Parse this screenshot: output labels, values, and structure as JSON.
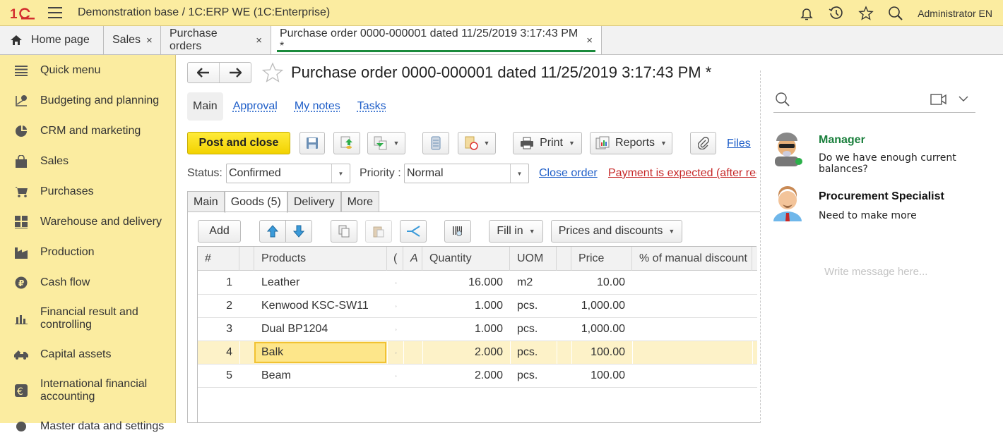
{
  "topbar": {
    "logo": "1C",
    "title": "Demonstration base / 1C:ERP WE  (1C:Enterprise)",
    "icons": [
      "menu-icon",
      "bell-icon",
      "history-icon",
      "star-icon",
      "search-icon"
    ],
    "user": "Administrator EN"
  },
  "tabs": [
    {
      "label": "Home page",
      "icon": "home-icon",
      "closable": false
    },
    {
      "label": "Sales",
      "closable": true
    },
    {
      "label": "Purchase orders",
      "closable": true
    },
    {
      "label": "Purchase order 0000-000001 dated 11/25/2019 3:17:43 PM *",
      "closable": true,
      "active": true
    }
  ],
  "tab_close_glyph": "×",
  "sidebar": {
    "items": [
      {
        "label": "Quick menu",
        "icon": "list-icon"
      },
      {
        "label": "Budgeting and planning",
        "icon": "budget-chart-icon"
      },
      {
        "label": "CRM and marketing",
        "icon": "pie-chart-icon"
      },
      {
        "label": "Sales",
        "icon": "shopping-bag-icon"
      },
      {
        "label": "Purchases",
        "icon": "cart-icon"
      },
      {
        "label": "Warehouse and delivery",
        "icon": "warehouse-icon"
      },
      {
        "label": "Production",
        "icon": "factory-icon"
      },
      {
        "label": "Cash flow",
        "icon": "ruble-coin-icon"
      },
      {
        "label": "Financial result and controlling",
        "icon": "bar-chart-icon"
      },
      {
        "label": "Capital assets",
        "icon": "truck-icon"
      },
      {
        "label": "International financial accounting",
        "icon": "euro-icon"
      },
      {
        "label": "Master data and settings",
        "icon": "gear-icon"
      }
    ]
  },
  "document": {
    "title": "Purchase order 0000-000001 dated 11/25/2019 3:17:43 PM *",
    "form_tabs": [
      {
        "label": "Main",
        "active": true
      },
      {
        "label": "Approval"
      },
      {
        "label": "My notes"
      },
      {
        "label": "Tasks"
      }
    ],
    "toolbar": {
      "post_and_close": "Post and close",
      "print": "Print",
      "reports": "Reports",
      "files": "Files"
    },
    "status_label": "Status:",
    "status_value": "Confirmed",
    "priority_label": "Priority :",
    "priority_value": "Normal",
    "close_order": "Close order",
    "payment_warning": "Payment is expected (after rec",
    "page_tabs": [
      {
        "label": "Main"
      },
      {
        "label": "Goods (5)",
        "active": true
      },
      {
        "label": "Delivery"
      },
      {
        "label": "More"
      }
    ],
    "goods_toolbar": {
      "add": "Add",
      "fill_in": "Fill in",
      "prices_and_discounts": "Prices and discounts"
    },
    "table": {
      "columns": [
        "#",
        "",
        "Products",
        "(",
        "A",
        "Quantity",
        "UOM",
        "",
        "Price",
        "% of manual discount"
      ],
      "rows": [
        {
          "n": "1",
          "product": "Leather",
          "quantity": "16.000",
          "uom": "m2",
          "price": "10.00",
          "discount": ""
        },
        {
          "n": "2",
          "product": "Kenwood KSC-SW11",
          "quantity": "1.000",
          "uom": "pcs.",
          "price": "1,000.00",
          "discount": ""
        },
        {
          "n": "3",
          "product": "Dual BP1204",
          "quantity": "1.000",
          "uom": "pcs.",
          "price": "1,000.00",
          "discount": ""
        },
        {
          "n": "4",
          "product": "Balk",
          "quantity": "2.000",
          "uom": "pcs.",
          "price": "100.00",
          "discount": "",
          "selected": true
        },
        {
          "n": "5",
          "product": "Beam",
          "quantity": "2.000",
          "uom": "pcs.",
          "price": "100.00",
          "discount": ""
        }
      ],
      "char_marker": "◦"
    }
  },
  "chat": {
    "messages": [
      {
        "author": "Manager",
        "text": "Do we have enough current balances?",
        "online": true,
        "author_color": "#1a7f3c"
      },
      {
        "author": "Procurement Specialist",
        "text": "Need to make more",
        "author_color": "#111111"
      }
    ],
    "input_placeholder": "Write message here..."
  },
  "colors": {
    "accent_yellow": "#fbeca0",
    "primary_button": "#f6dc00",
    "active_tab_underline": "#1a8a3c",
    "link": "#1e5ec8",
    "warning": "#c62828",
    "selected_row": "#fdf2c8"
  }
}
